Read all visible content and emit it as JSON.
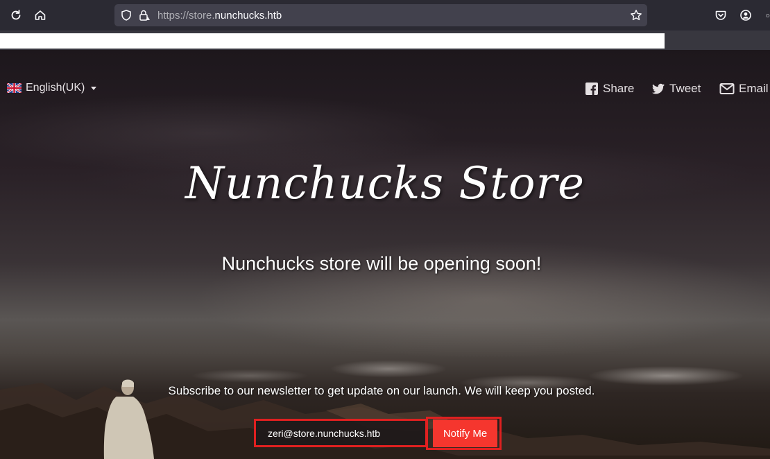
{
  "browser": {
    "url_prefix": "https://store.",
    "url_domain": "nunchucks.htb"
  },
  "language": {
    "label": "English(UK)"
  },
  "social": {
    "share": "Share",
    "tweet": "Tweet",
    "email": "Email"
  },
  "hero": {
    "title": "Nunchucks Store",
    "subtitle": "Nunchucks store will be opening soon!"
  },
  "newsletter": {
    "text": "Subscribe to our newsletter to get update on our launch. We will keep you posted.",
    "email_value": "zeri@store.nunchucks.htb",
    "button_label": "Notify Me"
  },
  "colors": {
    "accent": "#f5362e",
    "highlight": "#e02020"
  }
}
